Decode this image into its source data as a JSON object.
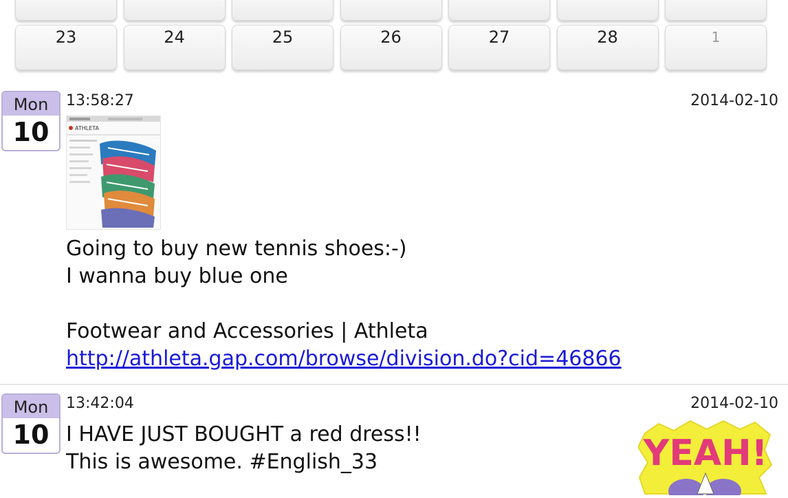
{
  "calendar": {
    "top_row": [
      "",
      "",
      "",
      "",
      "",
      "",
      ""
    ],
    "bottom_row": [
      "23",
      "24",
      "25",
      "26",
      "27",
      "28",
      "1"
    ]
  },
  "posts": [
    {
      "weekday": "Mon",
      "day": "10",
      "time": "13:58:27",
      "date": "2014-02-10",
      "thumbnail_label": "ATHLETA",
      "lines": [
        "Going to buy new tennis shoes:-)",
        "I wanna buy blue one",
        "",
        "Footwear and Accessories | Athleta"
      ],
      "link": "http://athleta.gap.com/browse/division.do?cid=46866"
    },
    {
      "weekday": "Mon",
      "day": "10",
      "time": "13:42:04",
      "date": "2014-02-10",
      "lines": [
        "I HAVE JUST BOUGHT a red dress!!",
        "This is awesome. #English_33"
      ],
      "sticker_text": "YEAH!"
    }
  ],
  "colors": {
    "badge_header": "#c9bfe8",
    "badge_border": "#b9aedb",
    "link": "#1a1ad8",
    "sticker_bg": "#f3ee3a",
    "sticker_text": "#e23a7a"
  }
}
